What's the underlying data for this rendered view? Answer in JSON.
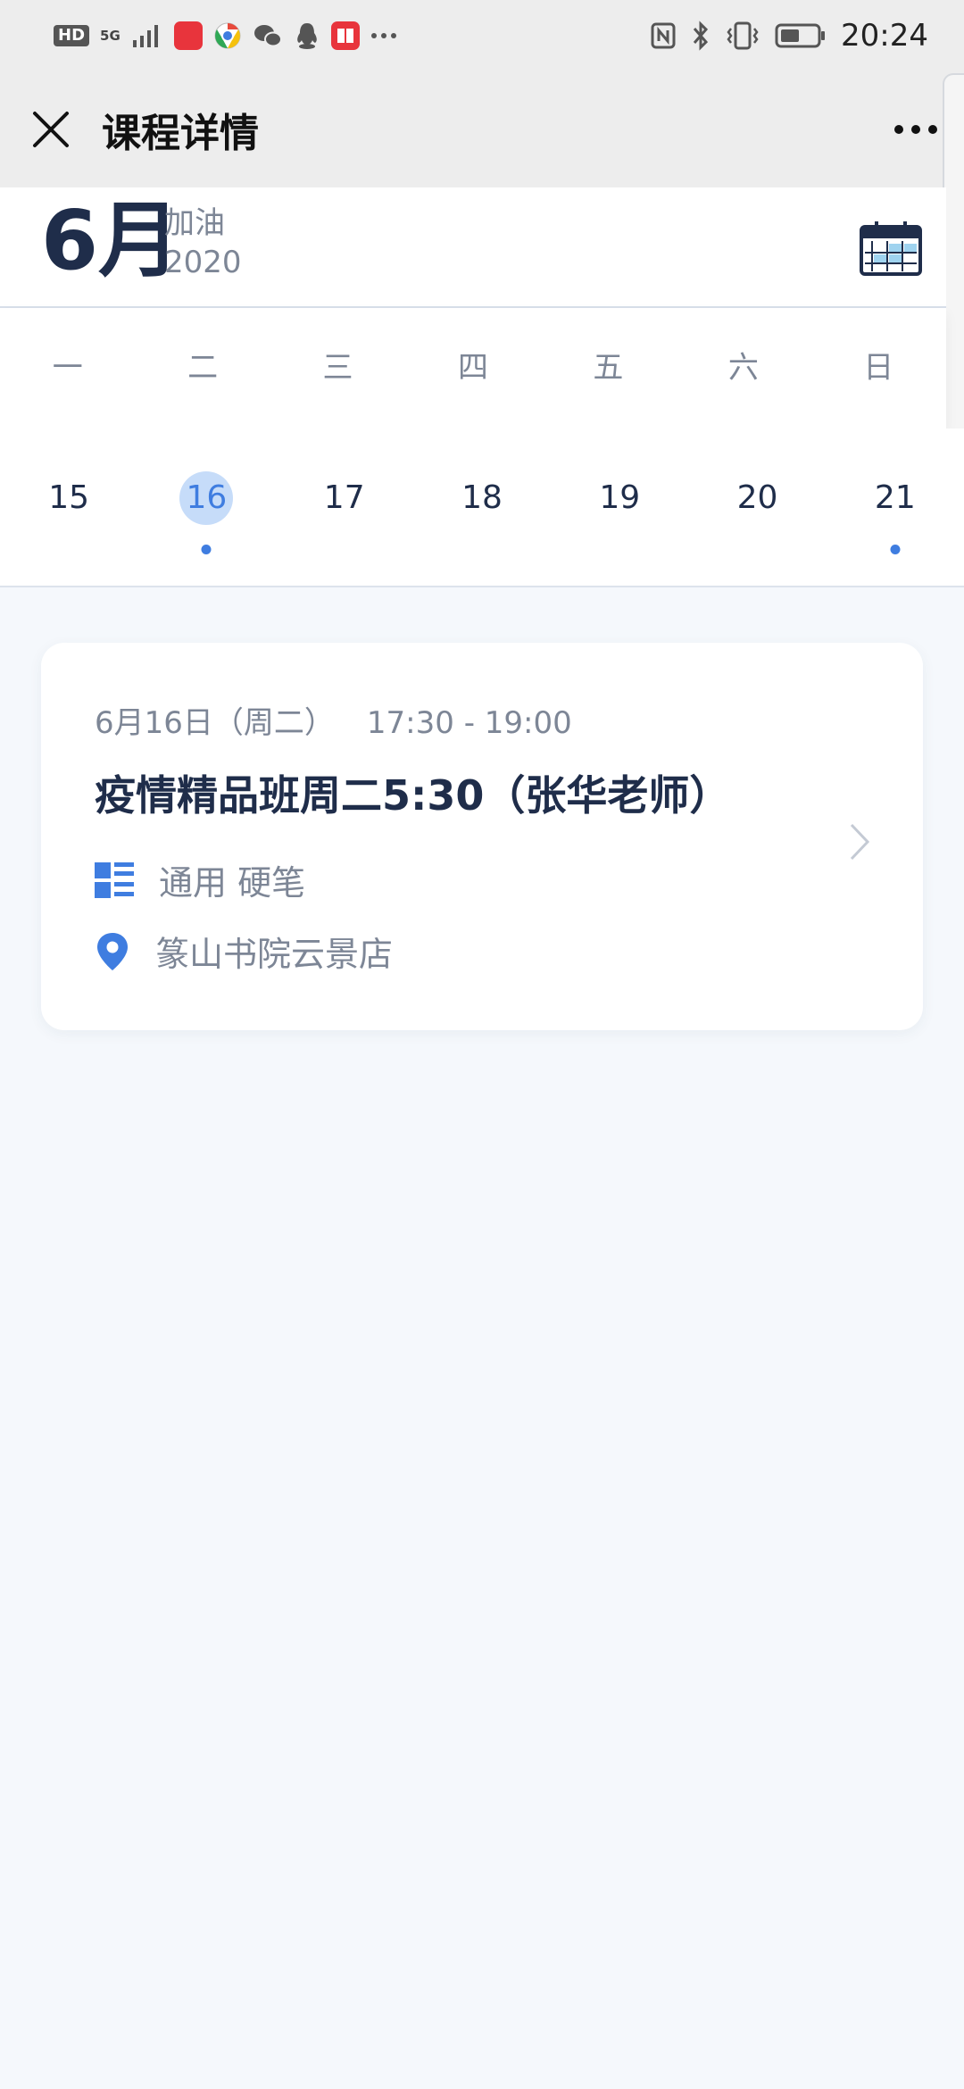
{
  "status_bar": {
    "badge": "HD",
    "network": "5G",
    "time": "20:24"
  },
  "header": {
    "title": "课程详情"
  },
  "calendar": {
    "month": "6月",
    "slogan": "加油",
    "year": "2020",
    "weekdays": [
      "一",
      "二",
      "三",
      "四",
      "五",
      "六",
      "日"
    ],
    "dates": [
      "15",
      "16",
      "17",
      "18",
      "19",
      "20",
      "21"
    ],
    "selected_date": "16",
    "dates_with_events": [
      "16",
      "21"
    ]
  },
  "course": {
    "date": "6月16日（周二）",
    "time_range": "17:30 - 19:00",
    "title": "疫情精品班周二5:30（张华老师）",
    "category": "通用 硬笔",
    "location": "篆山书院云景店"
  },
  "colors": {
    "accent": "#3f7de0",
    "selected_bg": "#c6dcf9",
    "text_dark": "#1f2d4a",
    "text_muted": "#7d8696",
    "page_bg": "#f5f8fc"
  }
}
